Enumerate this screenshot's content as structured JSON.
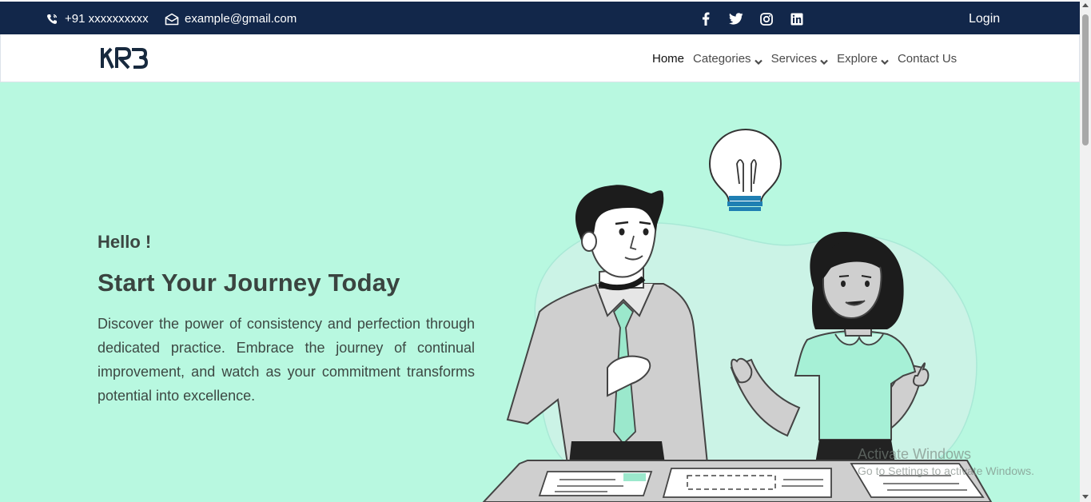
{
  "topbar": {
    "phone": "+91 xxxxxxxxxx",
    "email": "example@gmail.com",
    "phone_icon": "phone-icon",
    "email_icon": "envelope-icon",
    "social": [
      "facebook-icon",
      "twitter-icon",
      "instagram-icon",
      "linkedin-icon"
    ],
    "login_label": "Login"
  },
  "navbar": {
    "logo_text": "KRB",
    "items": [
      {
        "label": "Home",
        "has_dropdown": false
      },
      {
        "label": "Categories",
        "has_dropdown": true
      },
      {
        "label": "Services",
        "has_dropdown": true
      },
      {
        "label": "Explore",
        "has_dropdown": true
      },
      {
        "label": "Contact Us",
        "has_dropdown": false
      }
    ]
  },
  "hero": {
    "greeting": "Hello !",
    "title": "Start Your Journey Today",
    "description": "Discover the power of consistency and perfection through dedicated practice. Embrace the journey of continual improvement, and watch as your commitment transforms potential into excellence."
  },
  "watermark": {
    "line1": "Activate Windows",
    "line2": "Go to Settings to activate Windows."
  },
  "colors": {
    "topbar_bg": "#12274a",
    "hero_bg": "#b8f8e0",
    "accent": "#7de8c8"
  }
}
